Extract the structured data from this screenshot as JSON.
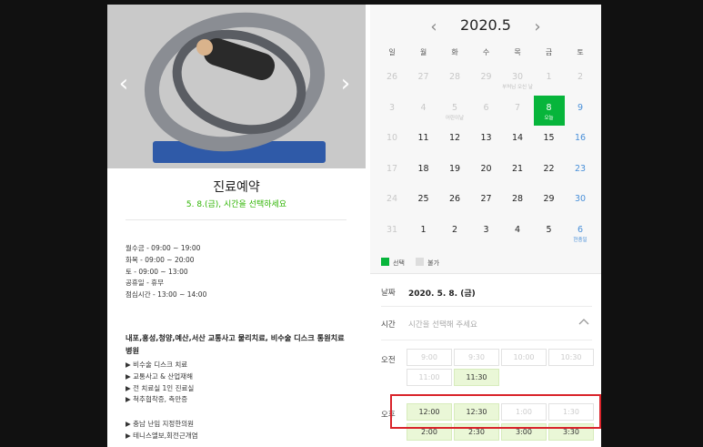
{
  "booking": {
    "title": "진료예약",
    "subtitle": "5. 8.(금), 시간을 선택하세요"
  },
  "hero": {
    "prev_icon": "chevron-left-icon",
    "next_icon": "chevron-right-icon"
  },
  "hours": [
    "월수금 - 09:00 ~ 19:00",
    "화목 - 09:00 ~ 20:00",
    "토 - 09:00 ~ 13:00",
    "공휴일 - 휴무",
    "점심시간 - 13:00 ~ 14:00"
  ],
  "clinic_name": "내포,홍성,청양,예산,서산 교통사고 물리치료, 비수술 디스크 통원치료병원",
  "features": [
    "▶ 비수술 디스크 치료",
    "▶ 교통사고 & 산업재해",
    "▶ 전 치료실 1인 진료실",
    "▶ 척추협착증, 측만증"
  ],
  "features2": [
    "▶ 충남 난임 지정한의원",
    "▶ 테니스엘보,회전근개염"
  ],
  "calendar": {
    "month_label": "2020.5",
    "weekdays": [
      "일",
      "월",
      "화",
      "수",
      "목",
      "금",
      "토"
    ],
    "weeks": [
      [
        {
          "d": "26",
          "s": "dis"
        },
        {
          "d": "27",
          "s": "dis"
        },
        {
          "d": "28",
          "s": "dis"
        },
        {
          "d": "29",
          "s": "dis"
        },
        {
          "d": "30",
          "s": "dis",
          "note": "부처님 오신 날"
        },
        {
          "d": "1",
          "s": "dis"
        },
        {
          "d": "2",
          "s": "dis"
        }
      ],
      [
        {
          "d": "3",
          "s": "dis"
        },
        {
          "d": "4",
          "s": "dis"
        },
        {
          "d": "5",
          "s": "dis",
          "note": "어린이날"
        },
        {
          "d": "6",
          "s": "dis"
        },
        {
          "d": "7",
          "s": "dis"
        },
        {
          "d": "8",
          "s": "sel",
          "note": "오늘"
        },
        {
          "d": "9",
          "s": "sat"
        }
      ],
      [
        {
          "d": "10",
          "s": "dis"
        },
        {
          "d": "11",
          "s": ""
        },
        {
          "d": "12",
          "s": ""
        },
        {
          "d": "13",
          "s": ""
        },
        {
          "d": "14",
          "s": ""
        },
        {
          "d": "15",
          "s": ""
        },
        {
          "d": "16",
          "s": "sat"
        }
      ],
      [
        {
          "d": "17",
          "s": "dis"
        },
        {
          "d": "18",
          "s": ""
        },
        {
          "d": "19",
          "s": ""
        },
        {
          "d": "20",
          "s": ""
        },
        {
          "d": "21",
          "s": ""
        },
        {
          "d": "22",
          "s": ""
        },
        {
          "d": "23",
          "s": "sat"
        }
      ],
      [
        {
          "d": "24",
          "s": "dis"
        },
        {
          "d": "25",
          "s": ""
        },
        {
          "d": "26",
          "s": ""
        },
        {
          "d": "27",
          "s": ""
        },
        {
          "d": "28",
          "s": ""
        },
        {
          "d": "29",
          "s": ""
        },
        {
          "d": "30",
          "s": "sat"
        }
      ],
      [
        {
          "d": "31",
          "s": "dis"
        },
        {
          "d": "1",
          "s": ""
        },
        {
          "d": "2",
          "s": ""
        },
        {
          "d": "3",
          "s": ""
        },
        {
          "d": "4",
          "s": ""
        },
        {
          "d": "5",
          "s": ""
        },
        {
          "d": "6",
          "s": "sat hol",
          "note": "현충일"
        }
      ]
    ],
    "legend_available": "선택",
    "legend_unavailable": "불가"
  },
  "form": {
    "date_label": "날짜",
    "date_value": "2020. 5. 8. (금)",
    "time_label": "시간",
    "time_placeholder": "시간을 선택해 주세요"
  },
  "slots": {
    "am_label": "오전",
    "pm_label": "오후",
    "am": [
      {
        "t": "9:00",
        "on": false
      },
      {
        "t": "9:30",
        "on": false
      },
      {
        "t": "10:00",
        "on": false
      },
      {
        "t": "10:30",
        "on": false
      },
      {
        "t": "11:00",
        "on": false
      },
      {
        "t": "11:30",
        "on": true
      }
    ],
    "pm": [
      {
        "t": "12:00",
        "on": true
      },
      {
        "t": "12:30",
        "on": true
      },
      {
        "t": "1:00",
        "on": false
      },
      {
        "t": "1:30",
        "on": false
      },
      {
        "t": "2:00",
        "on": true
      },
      {
        "t": "2:30",
        "on": true
      },
      {
        "t": "3:00",
        "on": true
      },
      {
        "t": "3:30",
        "on": true
      }
    ]
  },
  "colors": {
    "accent": "#07b53b",
    "saturday": "#4a90d9",
    "highlight": "#d9232a"
  }
}
